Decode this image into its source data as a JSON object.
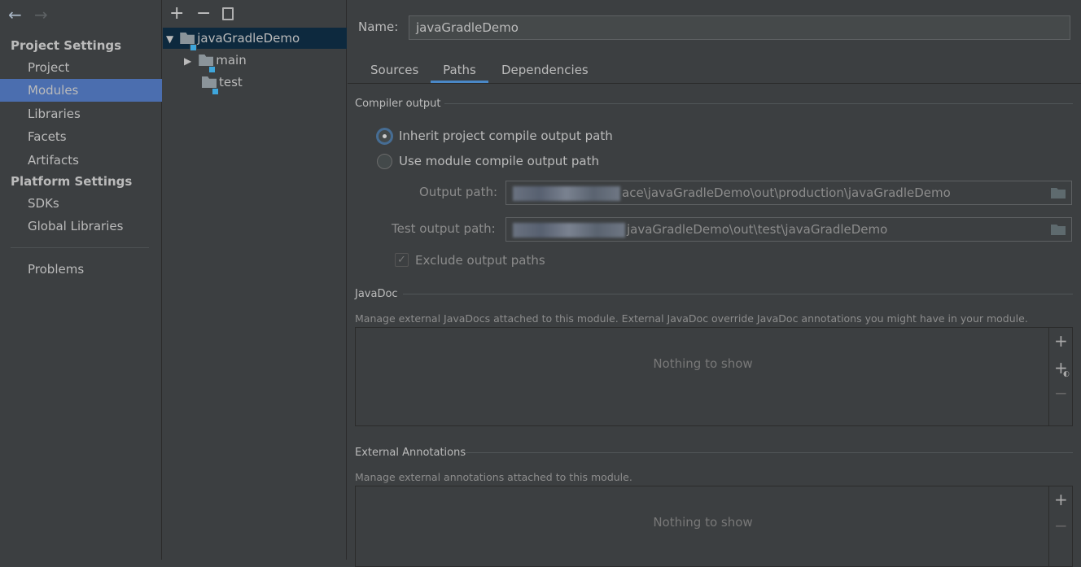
{
  "sidebar": {
    "back_icon": "arrow-left-icon",
    "forward_icon": "arrow-right-icon",
    "project_settings_header": "Project Settings",
    "platform_settings_header": "Platform Settings",
    "items": [
      {
        "label": "Project"
      },
      {
        "label": "Modules",
        "selected": true
      },
      {
        "label": "Libraries"
      },
      {
        "label": "Facets"
      },
      {
        "label": "Artifacts"
      },
      {
        "label": "SDKs"
      },
      {
        "label": "Global Libraries"
      },
      {
        "label": "Problems"
      }
    ]
  },
  "tree": {
    "toolbar": {
      "add": "+",
      "remove": "−",
      "copy_icon": "copy-icon"
    },
    "root": "javaGradleDemo",
    "children": [
      "main",
      "test"
    ]
  },
  "main": {
    "name_label": "Name:",
    "name_value": "javaGradleDemo",
    "tabs": [
      {
        "label": "Sources"
      },
      {
        "label": "Paths",
        "active": true
      },
      {
        "label": "Dependencies"
      }
    ],
    "compiler_output": {
      "title": "Compiler output",
      "inherit_label": "Inherit project compile output path",
      "use_module_label": "Use module compile output path",
      "selected": "inherit",
      "output_path_label": "Output path:",
      "output_path_value": "ace\\javaGradleDemo\\out\\production\\javaGradleDemo",
      "test_output_path_label": "Test output path:",
      "test_output_path_value": "javaGradleDemo\\out\\test\\javaGradleDemo",
      "exclude_label": "Exclude output paths",
      "exclude_checked": true
    },
    "javadoc": {
      "title": "JavaDoc",
      "hint": "Manage external JavaDocs attached to this module. External JavaDoc override JavaDoc annotations you might have in your module.",
      "empty": "Nothing to show"
    },
    "annotations": {
      "title": "External Annotations",
      "hint": "Manage external annotations attached to this module.",
      "empty": "Nothing to show"
    }
  },
  "colors": {
    "selection": "#4b6eaf",
    "tree_selection": "#0d293e",
    "accent": "#4a88c7",
    "module_badge": "#3ea6dc"
  }
}
